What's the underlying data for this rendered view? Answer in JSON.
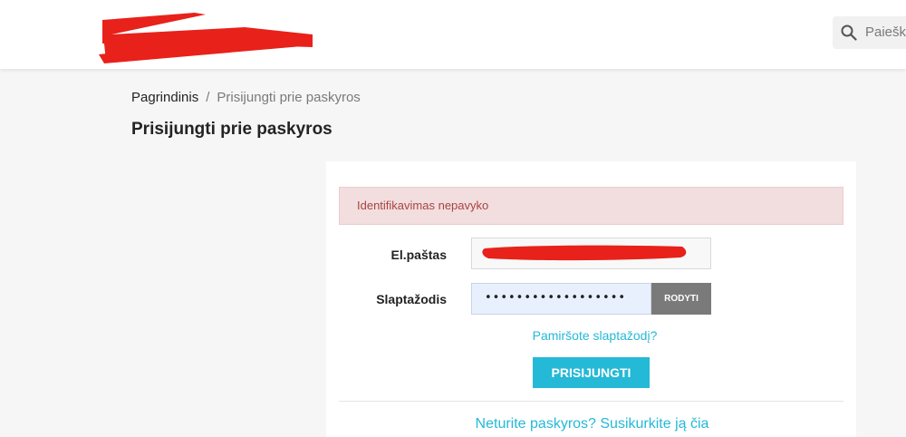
{
  "header": {
    "logo_redacted": true,
    "search": {
      "placeholder": "Paieška"
    }
  },
  "breadcrumb": {
    "home": "Pagrindinis",
    "separator": "/",
    "current": "Prisijungti prie paskyros"
  },
  "page": {
    "title": "Prisijungti prie paskyros"
  },
  "login_form": {
    "error_message": "Identifikavimas nepavyko",
    "email": {
      "label": "El.paštas",
      "value_redacted": true
    },
    "password": {
      "label": "Slaptažodis",
      "masked_value": "••••••••••••••••••",
      "show_button": "RODYTI"
    },
    "forgot_link": "Pamiršote slaptažodį?",
    "submit_button": "PRISIJUNGTI",
    "register_link": "Neturite paskyros? Susikurkite ją čia"
  },
  "colors": {
    "accent": "#24b9d7",
    "error_bg": "#f2dede",
    "error_text": "#a94442",
    "redaction": "#e8211b",
    "show_button_bg": "#7a7a7a"
  }
}
